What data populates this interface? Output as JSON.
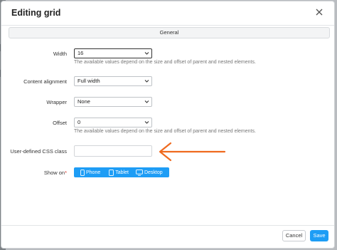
{
  "dialog": {
    "title": "Editing grid",
    "tab_label": "General"
  },
  "form": {
    "width": {
      "label": "Width",
      "value": "16",
      "help": "The available values depend on the size and offset of parent and nested elements."
    },
    "content_alignment": {
      "label": "Content alignment",
      "value": "Full width"
    },
    "wrapper": {
      "label": "Wrapper",
      "value": "None"
    },
    "offset": {
      "label": "Offset",
      "value": "0",
      "help": "The available values depend on the size and offset of parent and nested elements."
    },
    "css_class": {
      "label": "User-defined CSS class",
      "value": ""
    },
    "show_on": {
      "label": "Show on",
      "required_mark": "*",
      "devices": [
        {
          "label": "Phone",
          "icon": "phone-icon"
        },
        {
          "label": "Tablet",
          "icon": "tablet-icon"
        },
        {
          "label": "Desktop",
          "icon": "desktop-icon"
        }
      ]
    }
  },
  "footer": {
    "cancel_label": "Cancel",
    "save_label": "Save"
  },
  "colors": {
    "accent": "#1e9df5",
    "annotation_arrow": "#ef6a1f",
    "required": "#d9352a"
  }
}
